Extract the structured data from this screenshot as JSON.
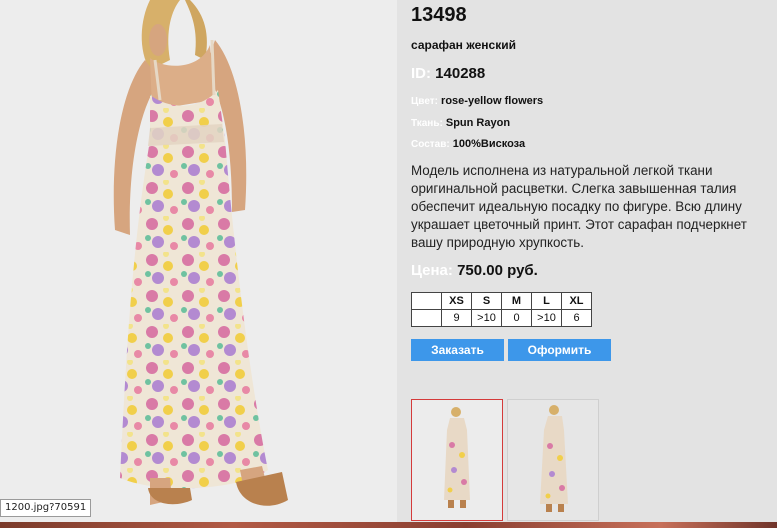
{
  "product": {
    "title": "13498",
    "subtitle": "сарафан женский",
    "id_label": "ID:",
    "id_value": "140288",
    "color_label": "Цвет:",
    "color_value": "rose-yellow flowers",
    "fabric_label": "Ткань:",
    "fabric_value": "Spun Rayon",
    "composition_label": "Состав:",
    "composition_value": "100%Вискоза",
    "description": "Модель исполнена из натуральной легкой ткани оригинальной расцветки. Слегка завышенная талия обеспечит идеальную посадку по фигуре. Всю длину украшает цветочный принт. Этот сарафан подчеркнет вашу природную хрупкость.",
    "price_label": "Цена:",
    "price_value": "750.00 руб."
  },
  "sizes": {
    "headers": [
      "XS",
      "S",
      "M",
      "L",
      "XL"
    ],
    "stock": [
      "9",
      ">10",
      "0",
      ">10",
      "6"
    ]
  },
  "buttons": {
    "order": "Заказать",
    "checkout": "Оформить"
  },
  "image": {
    "url_tag": "1200.jpg?70591"
  },
  "colors": {
    "button": "#3d97ea",
    "selected_thumb_border": "#d43a3a",
    "label_white": "#ffffff"
  }
}
